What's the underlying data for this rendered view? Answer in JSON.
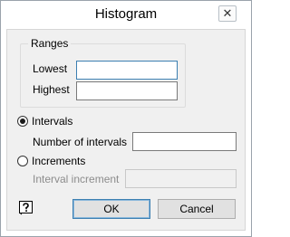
{
  "window": {
    "title": "Histogram",
    "close_glyph": "✕"
  },
  "ranges": {
    "legend": "Ranges",
    "lowest_label": "Lowest",
    "lowest_value": "",
    "highest_label": "Highest",
    "highest_value": ""
  },
  "intervals": {
    "label": "Intervals",
    "selected": true,
    "number_label": "Number of intervals",
    "number_value": ""
  },
  "increments": {
    "label": "Increments",
    "selected": false,
    "increment_label": "Interval increment",
    "increment_value": ""
  },
  "buttons": {
    "ok": "OK",
    "cancel": "Cancel"
  },
  "icons": {
    "help": "help-question-icon",
    "close": "close-icon"
  }
}
